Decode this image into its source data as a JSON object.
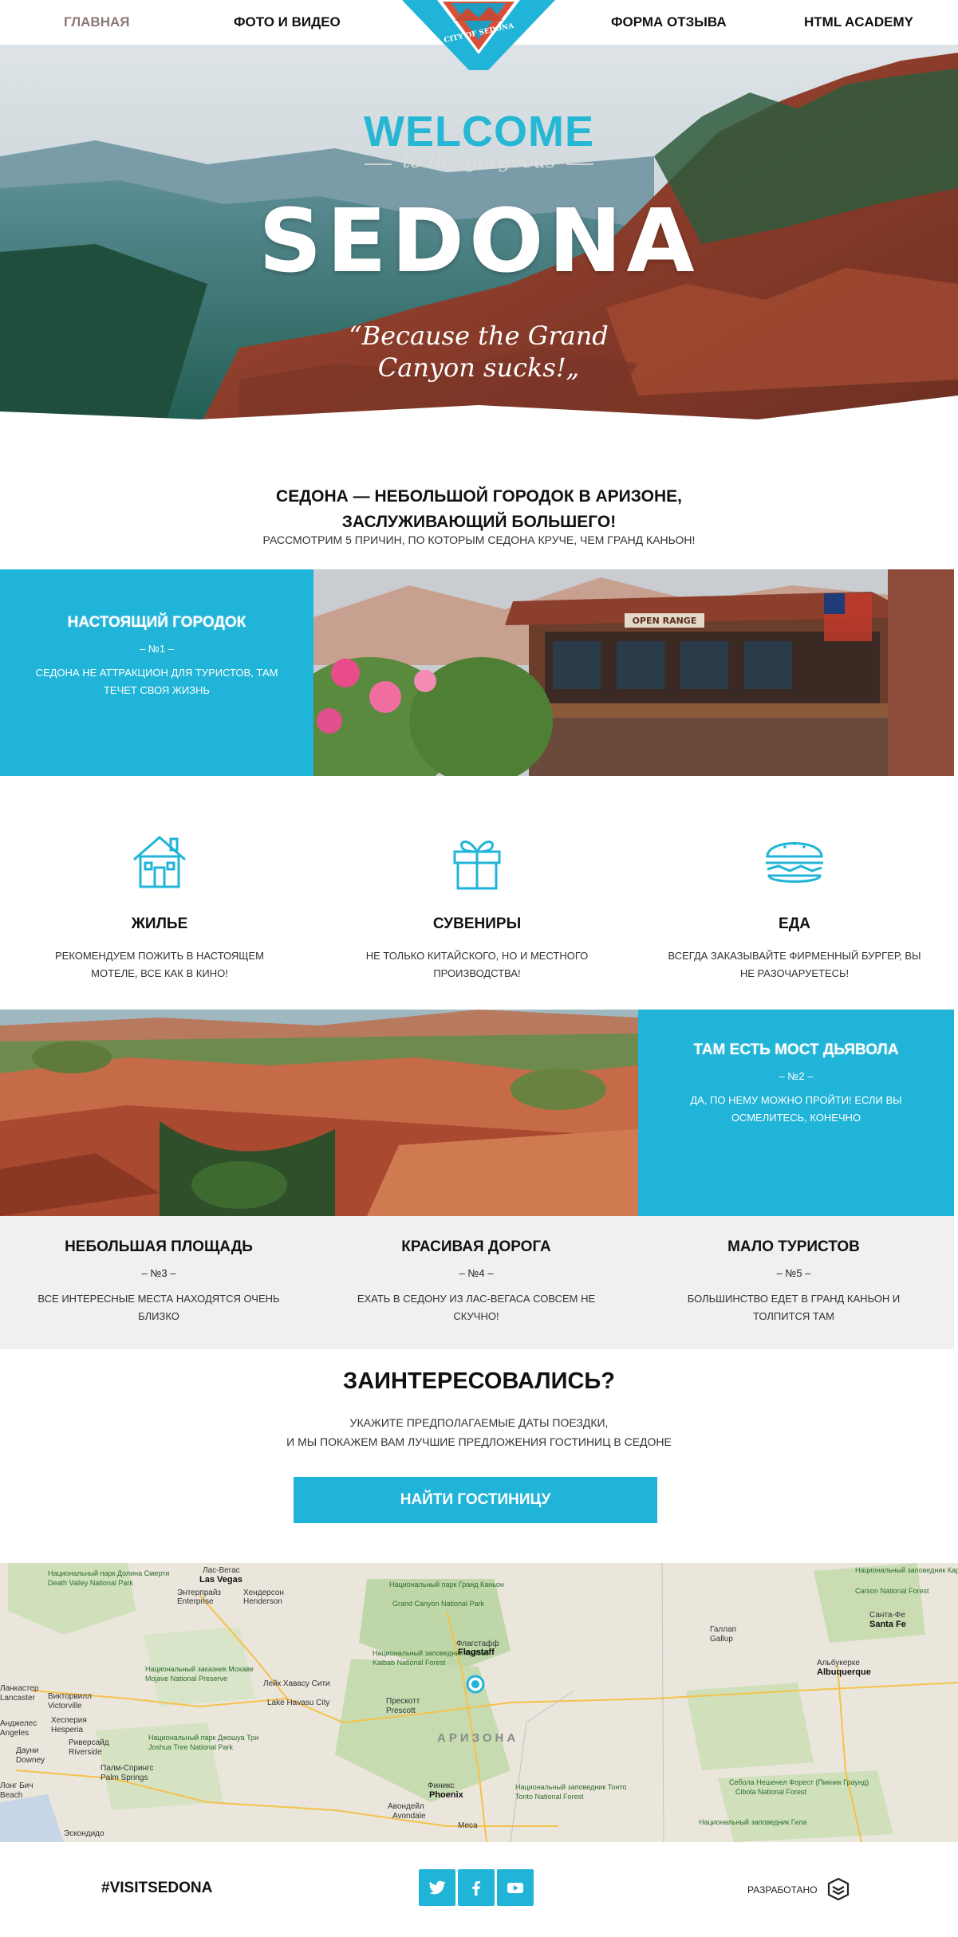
{
  "nav": {
    "items": [
      {
        "label": "ГЛАВНАЯ",
        "active": true
      },
      {
        "label": "ФОТО И ВИДЕО"
      },
      {
        "label": "ФОРМА ОТЗЫВА"
      },
      {
        "label": "HTML ACADEMY"
      }
    ],
    "logo_text": "CITY OF SEDONA"
  },
  "hero": {
    "welcome": "WELCOME",
    "gorgeous": "to the gorgeous",
    "title": "SEDONA",
    "quote": "“Because the Grand Canyon sucks!„"
  },
  "intro": {
    "title_line1": "СЕДОНА — НЕБОЛЬШОЙ ГОРОДОК В АРИЗОНЕ,",
    "title_line2": "ЗАСЛУЖИВАЮЩИЙ БОЛЬШЕГО!",
    "subtitle": "РАССМОТРИМ 5 ПРИЧИН, ПО КОТОРЫМ СЕДОНА КРУЧЕ, ЧЕМ ГРАНД КАНЬОН!"
  },
  "features": [
    {
      "title": "НАСТОЯЩИЙ ГОРОДОК",
      "num": "– №1 –",
      "desc": "СЕДОНА НЕ АТТРАКЦИОН ДЛЯ ТУРИСТОВ, ТАМ ТЕЧЕТ СВОЯ ЖИЗНЬ"
    },
    {
      "title": "ТАМ ЕСТЬ МОСТ ДЬЯВОЛА",
      "num": "– №2 –",
      "desc": "ДА, ПО НЕМУ МОЖНО ПРОЙТИ! ЕСЛИ ВЫ ОСМЕЛИТЕСЬ, КОНЕЧНО"
    },
    {
      "title": "НЕБОЛЬШАЯ ПЛОЩАДЬ",
      "num": "– №3 –",
      "desc": "ВСЕ ИНТЕРЕСНЫЕ МЕСТА НАХОДЯТСЯ ОЧЕНЬ БЛИЗКО"
    },
    {
      "title": "КРАСИВАЯ ДОРОГА",
      "num": "– №4 –",
      "desc": "ЕХАТЬ В СЕДОНУ ИЗ ЛАС-ВЕГАСА СОВСЕМ НЕ СКУЧНО!"
    },
    {
      "title": "МАЛО ТУРИСТОВ",
      "num": "– №5 –",
      "desc": "БОЛЬШИНСТВО ЕДЕТ В ГРАНД КАНЬОН И ТОЛПИТСЯ ТАМ"
    }
  ],
  "sign_text": "OPEN RANGE",
  "icons": [
    {
      "icon": "house-icon",
      "title": "ЖИЛЬЕ",
      "desc": "РЕКОМЕНДУЕМ ПОЖИТЬ В НАСТОЯЩЕМ МОТЕЛЕ, ВСЕ КАК В КИНО!"
    },
    {
      "icon": "gift-icon",
      "title": "СУВЕНИРЫ",
      "desc": "НЕ ТОЛЬКО КИТАЙСКОГО, НО И МЕСТНОГО ПРОИЗВОДСТВА!"
    },
    {
      "icon": "burger-icon",
      "title": "ЕДА",
      "desc": "ВСЕГДА ЗАКАЗЫВАЙТЕ ФИРМЕННЫЙ БУРГЕР, ВЫ НЕ РАЗОЧАРУЕТЕСЬ!"
    }
  ],
  "cta": {
    "title": "ЗАИНТЕРЕСОВАЛИСЬ?",
    "text_line1": "УКАЖИТЕ ПРЕДПОЛАГАЕМЫЕ ДАТЫ ПОЕЗДКИ,",
    "text_line2": "И МЫ ПОКАЖЕМ ВАМ ЛУЧШИЕ ПРЕДЛОЖЕНИЯ ГОСТИНИЦ В СЕДОНЕ",
    "button": "НАЙТИ ГОСТИНИЦУ"
  },
  "map": {
    "labels": [
      "Национальный парк Долина Смерти",
      "Death Valley National Park",
      "Лас-Вегас",
      "Las Vegas",
      "Энтерпрайз",
      "Enterprise",
      "Хендерсон",
      "Henderson",
      "Национальный парк Гранд Каньон",
      "Grand Canyon National Park",
      "Национальный заповедник Кайбаб",
      "Kaibab National Forest",
      "Флагстафф",
      "Flagstaff",
      "Прескотт",
      "Prescott",
      "Лейк Хавасу Сити",
      "Lake Havasu City",
      "АРИЗОНА",
      "Финикс",
      "Phoenix",
      "Авондейл",
      "Avondale",
      "Меса",
      "Национальный заповедник Тонто",
      "Tonto National Forest",
      "Викторвилл",
      "Victorville",
      "Хесперия",
      "Hesperia",
      "Риверсайд",
      "Riverside",
      "Палм-Спрингс",
      "Palm Springs",
      "Национальный заказник Мохаве",
      "Mojave National Preserve",
      "Национальный парк Джошуа Три",
      "Joshua Tree National Park",
      "Галлап",
      "Gallup",
      "Санта-Фе",
      "Santa Fe",
      "Альбукерке",
      "Albuquerque",
      "Национальный заповедник Карсон",
      "Carson National Forest",
      "Национальный заповедник Гила",
      "Cibola National Forest",
      "Себола Нешенел Форест (Пикник Граунд)",
      "Эскондидо",
      "Ланкастер",
      "Lancaster",
      "Дауни",
      "Downey",
      "Анджелес",
      "Angeles",
      "Лонг Бич",
      "Beach"
    ]
  },
  "footer": {
    "hashtag": "#VISITSEDONA",
    "made_by": "РАЗРАБОТАНО"
  },
  "colors": {
    "accent": "#20b4d8",
    "text": "#111111",
    "gray_strip": "#f0f0f0"
  }
}
